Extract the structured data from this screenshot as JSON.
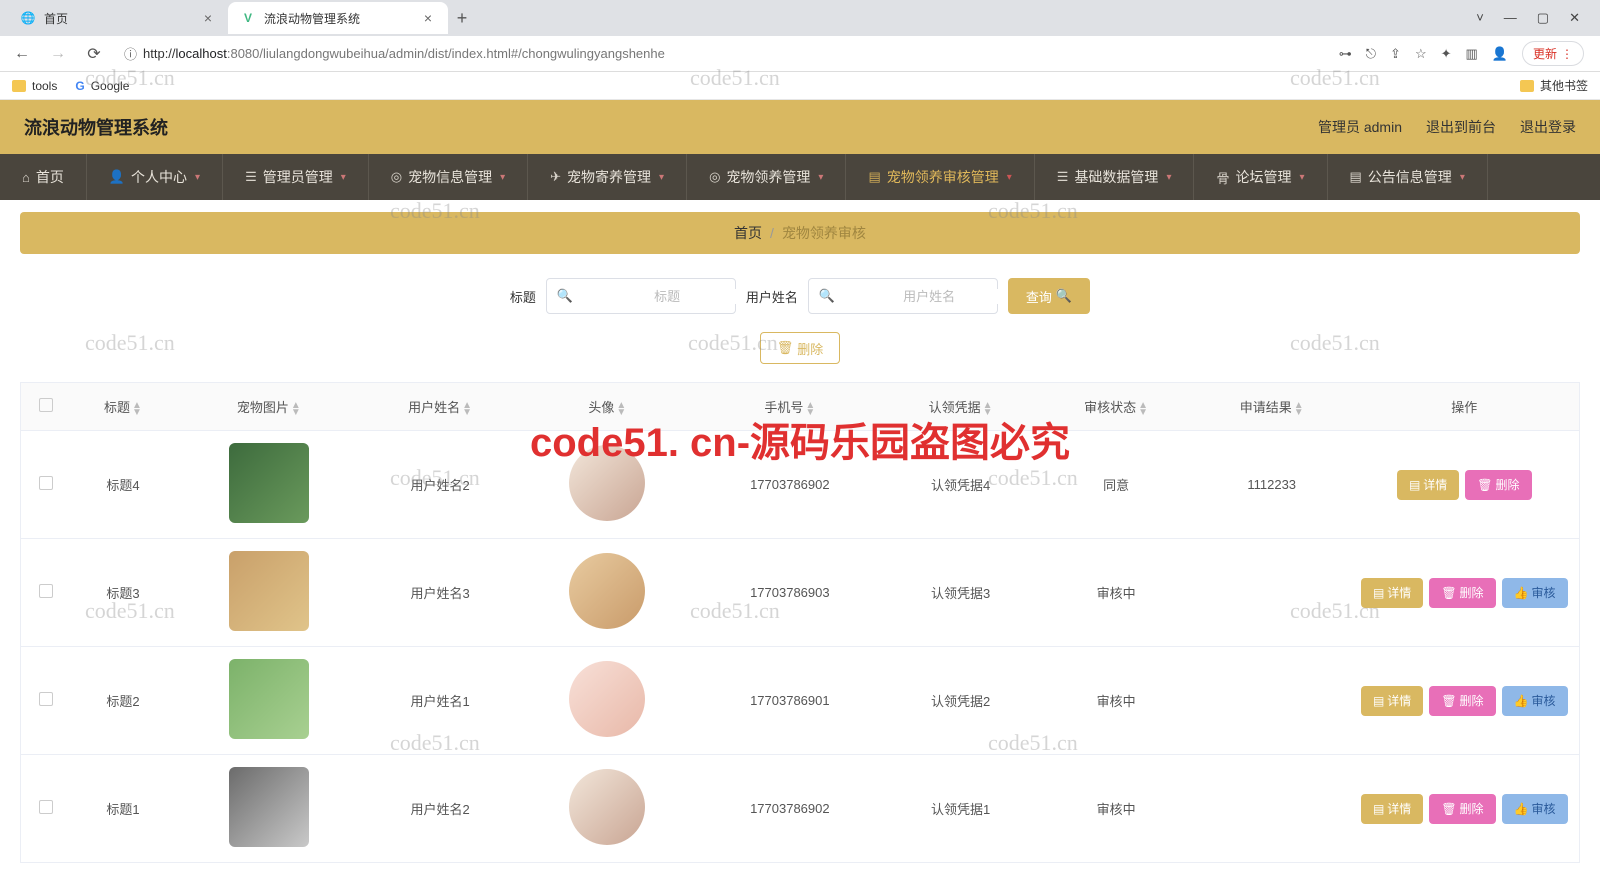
{
  "browser": {
    "tabs": [
      {
        "title": "首页",
        "favicon": "globe"
      },
      {
        "title": "流浪动物管理系统",
        "favicon": "vue"
      }
    ],
    "url_host": "localhost",
    "url_port": ":8080",
    "url_path": "/liulangdongwubeihua/admin/dist/index.html#/chongwulingyangshenhe",
    "update_label": "更新",
    "bookmarks": {
      "tools": "tools",
      "google": "Google",
      "other": "其他书签"
    }
  },
  "header": {
    "title": "流浪动物管理系统",
    "admin_label": "管理员 admin",
    "exit_front": "退出到前台",
    "logout": "退出登录"
  },
  "nav": {
    "home": "首页",
    "personal": "个人中心",
    "admin_mgmt": "管理员管理",
    "pet_info": "宠物信息管理",
    "pet_foster": "宠物寄养管理",
    "pet_adopt": "宠物领养管理",
    "pet_audit": "宠物领养审核管理",
    "base_data": "基础数据管理",
    "forum": "论坛管理",
    "notice": "公告信息管理"
  },
  "breadcrumb": {
    "home": "首页",
    "current": "宠物领养审核"
  },
  "search": {
    "title_label": "标题",
    "title_placeholder": "标题",
    "username_label": "用户姓名",
    "username_placeholder": "用户姓名",
    "query_label": "查询"
  },
  "bulk_delete_label": "删除",
  "table": {
    "columns": {
      "title": "标题",
      "pet_img": "宠物图片",
      "username": "用户姓名",
      "avatar": "头像",
      "phone": "手机号",
      "claim": "认领凭据",
      "audit_status": "审核状态",
      "apply_result": "申请结果",
      "ops": "操作"
    },
    "ops": {
      "detail": "详情",
      "delete": "删除",
      "audit": "审核"
    },
    "rows": [
      {
        "title": "标题4",
        "username": "用户姓名2",
        "phone": "17703786902",
        "claim": "认领凭据4",
        "audit_status": "同意",
        "apply_result": "1112233",
        "has_audit": false,
        "img": "img-a",
        "av": "av-a"
      },
      {
        "title": "标题3",
        "username": "用户姓名3",
        "phone": "17703786903",
        "claim": "认领凭据3",
        "audit_status": "审核中",
        "apply_result": "",
        "has_audit": true,
        "img": "img-b",
        "av": "av-b"
      },
      {
        "title": "标题2",
        "username": "用户姓名1",
        "phone": "17703786901",
        "claim": "认领凭据2",
        "audit_status": "审核中",
        "apply_result": "",
        "has_audit": true,
        "img": "img-c",
        "av": "av-c"
      },
      {
        "title": "标题1",
        "username": "用户姓名2",
        "phone": "17703786902",
        "claim": "认领凭据1",
        "audit_status": "审核中",
        "apply_result": "",
        "has_audit": true,
        "img": "img-d",
        "av": "av-a"
      }
    ]
  },
  "watermarks": {
    "text": "code51.cn",
    "big": "code51. cn-源码乐园盗图必究"
  }
}
